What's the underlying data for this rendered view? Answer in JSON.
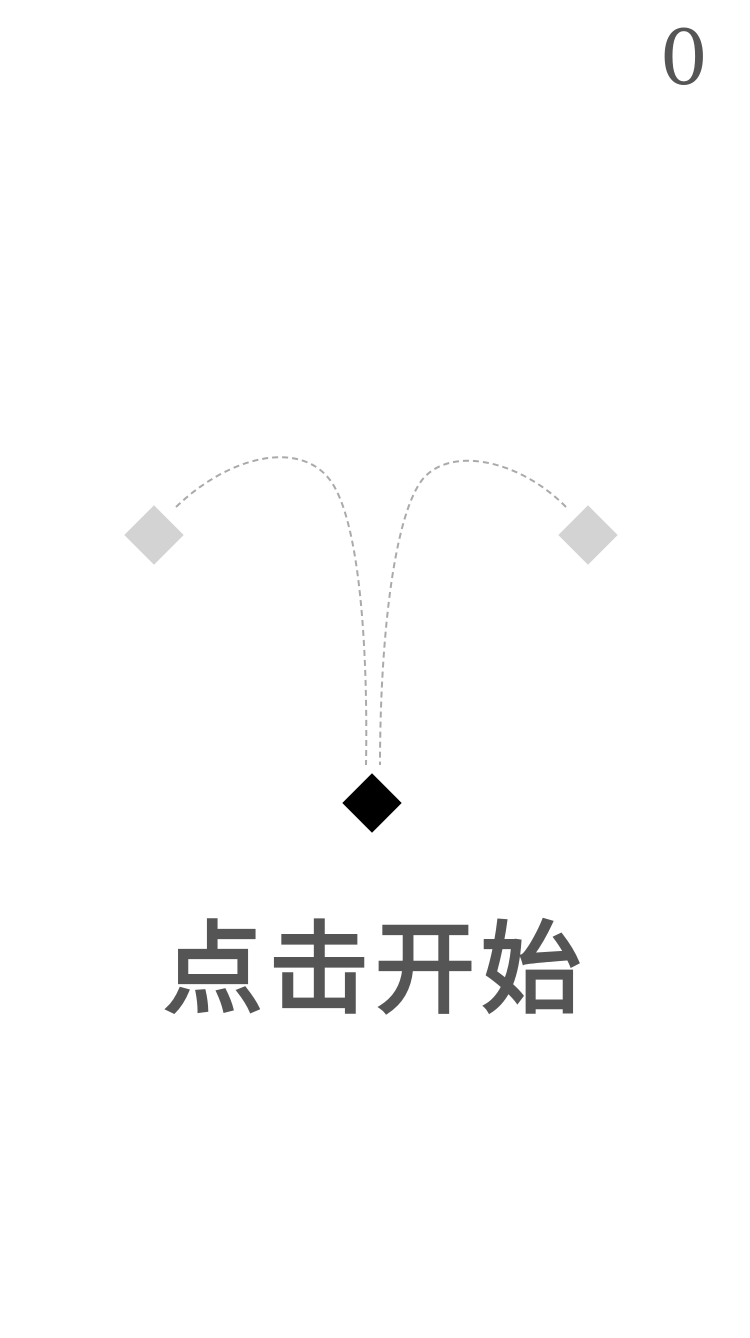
{
  "score": "0",
  "start_prompt": "点击开始",
  "colors": {
    "score_text": "#555555",
    "prompt_text": "#555555",
    "player_block": "#000000",
    "target_block": "#d3d3d3",
    "trajectory": "#aaaaaa",
    "background": "#ffffff"
  }
}
